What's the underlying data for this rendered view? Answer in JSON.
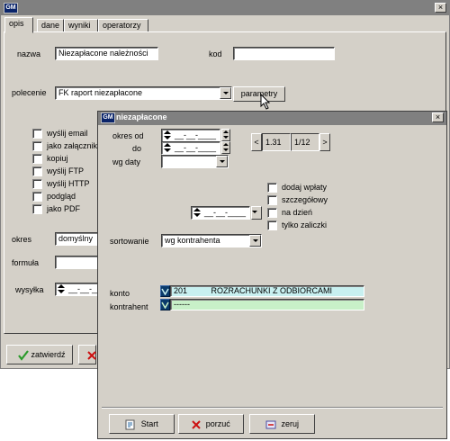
{
  "main": {
    "title_icon": "app-icon",
    "tabs": [
      "opis",
      "dane",
      "wyniki",
      "operatorzy"
    ],
    "nazwa_label": "nazwa",
    "nazwa_value": "Niezapłacone należności",
    "kod_label": "kod",
    "kod_value": "",
    "polecenie_label": "polecenie",
    "polecenie_value": "FK raport niezapłacone",
    "parametry_label": "parametry",
    "options": [
      "wyślij email",
      "jako załącznik",
      "kopiuj",
      "wyślij FTP",
      "wyślij HTTP",
      "podgląd",
      "jako PDF"
    ],
    "okres_label": "okres",
    "okres_value": "domyślny",
    "formula_label": "formuła",
    "formula_value": "",
    "wysylka_label": "wysyłka",
    "wysylka_value": "__-__-____",
    "zatwierdz_label": "zatwierdź"
  },
  "dialog": {
    "title": "niezapłacone",
    "okres_od_label": "okres od",
    "okres_od_value": "__-__-____",
    "do_label": "do",
    "do_value": "__-__-____",
    "period_prev": "<",
    "period_value": "1.31",
    "period_fraction": "1/​12",
    "period_next": ">",
    "wg_daty_label": "wg daty",
    "wg_daty_value": "",
    "date_value": "__-__-____",
    "checks": [
      "dodaj wpłaty",
      "szczegółowy",
      "na dzień",
      "tylko zaliczki"
    ],
    "sortowanie_label": "sortowanie",
    "sortowanie_value": "wg kontrahenta",
    "konto_label": "konto",
    "konto_code": "201",
    "konto_name": "ROZRACHUNKI Z ODBIORCAMI",
    "kontrahent_label": "kontrahent",
    "kontrahent_value": "------",
    "start_label": "Start",
    "porzuc_label": "porzuć",
    "zeruj_label": "zeruj"
  },
  "colors": {
    "titlebar": "#808080",
    "window_bg": "#d4d0c8",
    "konto_bg": "#c8f0f0",
    "kontrahent_bg": "#c8f0c8",
    "check_green": "#2a9a2a",
    "cross_red": "#cc1111"
  }
}
